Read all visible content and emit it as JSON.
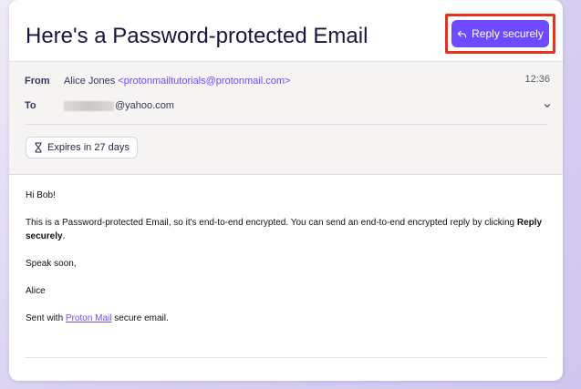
{
  "email": {
    "subject": "Here's a Password-protected Email",
    "reply_button_label": "Reply securely",
    "from_label": "From",
    "sender_name": "Alice Jones",
    "sender_email": "<protonmailtutorials@protonmail.com>",
    "time": "12:36",
    "to_label": "To",
    "recipient_domain": "@yahoo.com",
    "expires_label": "Expires in 27 days"
  },
  "body": {
    "greeting": "Hi Bob!",
    "para1_text": "This is a Password-protected Email, so it's end-to-end encrypted. You can send an end-to-end encrypted reply by clicking ",
    "para1_bold": "Reply securely",
    "para1_end": ".",
    "sign_off": "Speak soon,",
    "name": "Alice",
    "footer_prefix": "Sent with ",
    "footer_link": "Proton Mail",
    "footer_suffix": " secure email."
  },
  "colors": {
    "accent": "#6d4aff",
    "highlight": "#e8321e"
  },
  "icons": {
    "reply": "reply-arrow-icon",
    "expires": "hourglass-icon",
    "expand": "chevron-down-icon"
  }
}
